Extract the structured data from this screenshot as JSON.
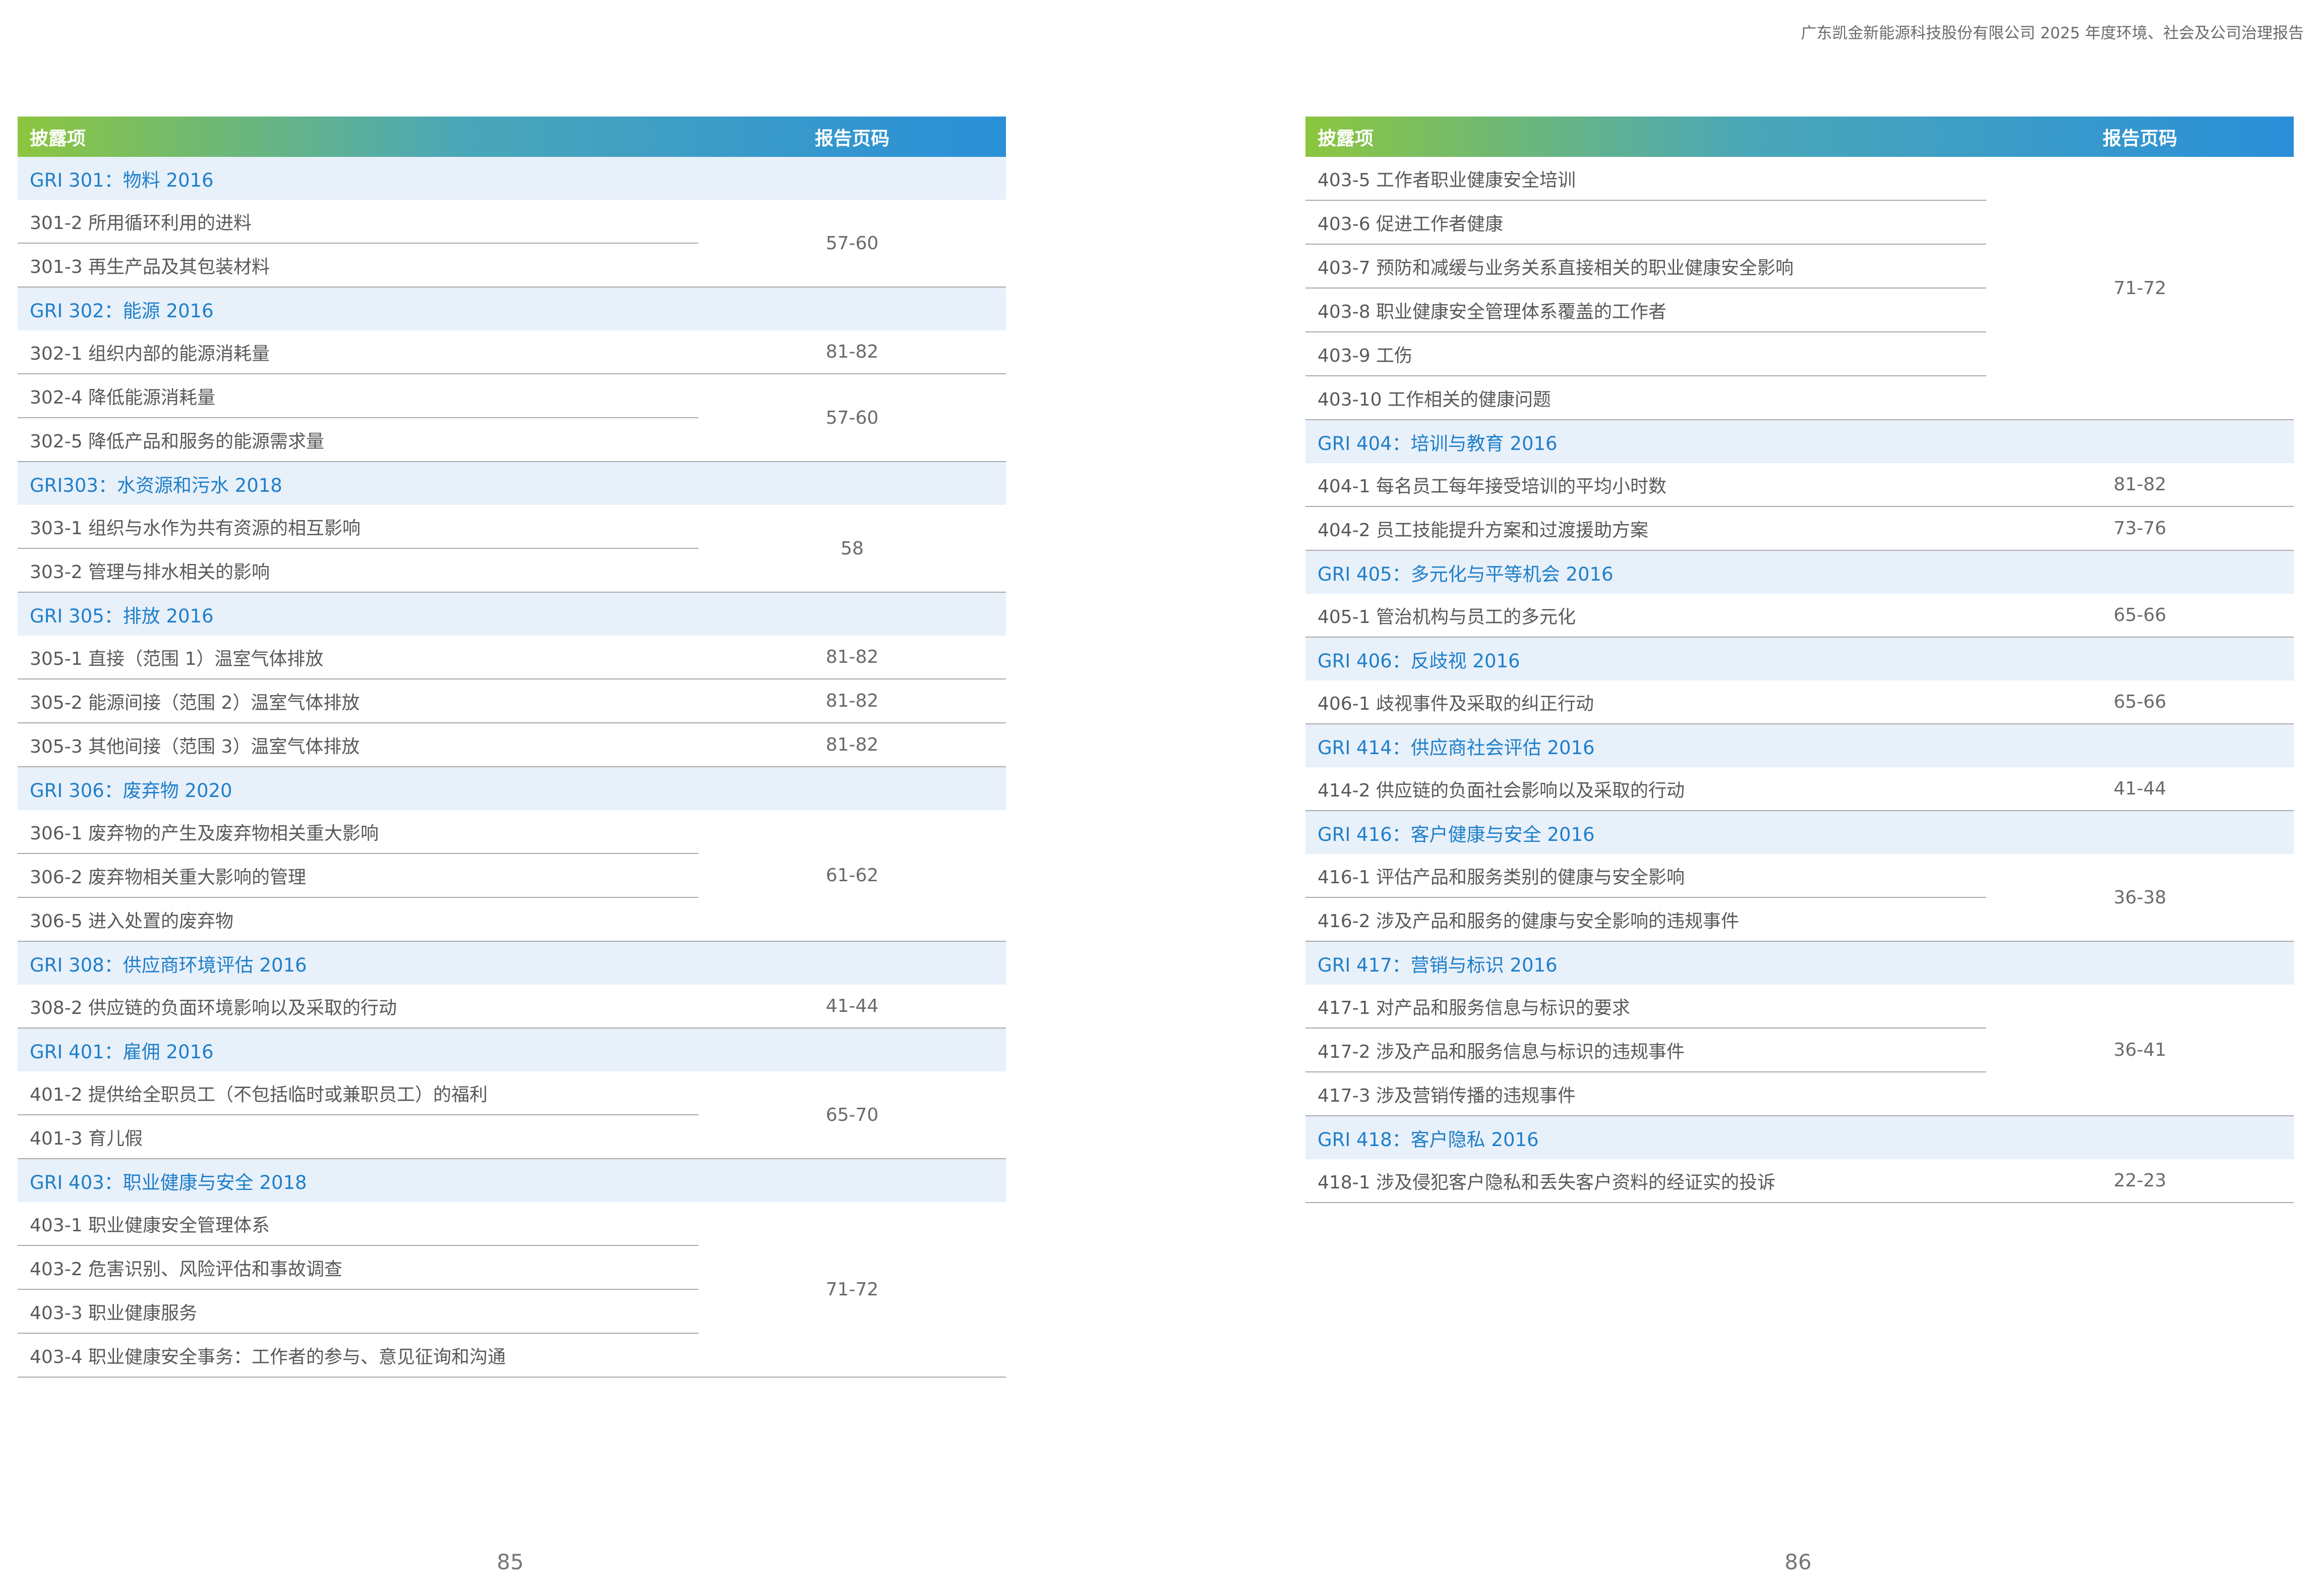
{
  "header": {
    "title": "广东凯金新能源科技股份有限公司   2025 年度环境、社会及公司治理报告"
  },
  "table": {
    "col_item": "披露项",
    "col_page": "报告页码"
  },
  "pages": {
    "left_number": "85",
    "right_number": "86"
  },
  "left_table": [
    {
      "section": "GRI 301：物料 2016"
    },
    {
      "item": "301-2 所用循环利用的进料",
      "page": "57-60",
      "rowspan": 2
    },
    {
      "item": "301-3 再生产品及其包装材料"
    },
    {
      "section": "GRI 302：能源 2016"
    },
    {
      "item": "302-1 组织内部的能源消耗量",
      "page": "81-82",
      "rowspan": 1
    },
    {
      "item": "302-4 降低能源消耗量",
      "page": "57-60",
      "rowspan": 2
    },
    {
      "item": "302-5 降低产品和服务的能源需求量"
    },
    {
      "section": "GRI303：水资源和污水 2018"
    },
    {
      "item": "303-1 组织与水作为共有资源的相互影响",
      "page": "58",
      "rowspan": 2
    },
    {
      "item": "303-2 管理与排水相关的影响"
    },
    {
      "section": "GRI 305：排放 2016"
    },
    {
      "item": "305-1 直接（范围 1）温室气体排放",
      "page": "81-82",
      "rowspan": 1
    },
    {
      "item": "305-2 能源间接（范围 2）温室气体排放",
      "page": "81-82",
      "rowspan": 1
    },
    {
      "item": "305-3 其他间接（范围 3）温室气体排放",
      "page": "81-82",
      "rowspan": 1
    },
    {
      "section": "GRI 306：废弃物 2020"
    },
    {
      "item": "306-1 废弃物的产生及废弃物相关重大影响",
      "page": "61-62",
      "rowspan": 3
    },
    {
      "item": "306-2 废弃物相关重大影响的管理"
    },
    {
      "item": "306-5 进入处置的废弃物"
    },
    {
      "section": "GRI 308：供应商环境评估 2016"
    },
    {
      "item": "308-2 供应链的负面环境影响以及采取的行动",
      "page": "41-44",
      "rowspan": 1
    },
    {
      "section": "GRI 401：雇佣 2016"
    },
    {
      "item": "401-2 提供给全职员工（不包括临时或兼职员工）的福利",
      "page": "65-70",
      "rowspan": 2
    },
    {
      "item": "401-3 育儿假"
    },
    {
      "section": "GRI 403：职业健康与安全 2018"
    },
    {
      "item": "403-1 职业健康安全管理体系",
      "page": "71-72",
      "rowspan": 4
    },
    {
      "item": "403-2 危害识别、风险评估和事故调查"
    },
    {
      "item": "403-3 职业健康服务"
    },
    {
      "item": "403-4 职业健康安全事务：工作者的参与、意见征询和沟通"
    }
  ],
  "right_table": [
    {
      "item": "403-5 工作者职业健康安全培训",
      "page": "71-72",
      "rowspan": 6
    },
    {
      "item": "403-6 促进工作者健康"
    },
    {
      "item": "403-7 预防和减缓与业务关系直接相关的职业健康安全影响"
    },
    {
      "item": "403-8 职业健康安全管理体系覆盖的工作者"
    },
    {
      "item": "403-9 工伤"
    },
    {
      "item": "403-10 工作相关的健康问题"
    },
    {
      "section": "GRI 404：培训与教育 2016"
    },
    {
      "item": "404-1 每名员工每年接受培训的平均小时数",
      "page": "81-82",
      "rowspan": 1
    },
    {
      "item": "404-2 员工技能提升方案和过渡援助方案",
      "page": "73-76",
      "rowspan": 1
    },
    {
      "section": "GRI 405：多元化与平等机会 2016"
    },
    {
      "item": "405-1 管治机构与员工的多元化",
      "page": "65-66",
      "rowspan": 1
    },
    {
      "section": "GRI 406：反歧视 2016"
    },
    {
      "item": "406-1 歧视事件及采取的纠正行动",
      "page": "65-66",
      "rowspan": 1
    },
    {
      "section": "GRI 414：供应商社会评估 2016"
    },
    {
      "item": "414-2 供应链的负面社会影响以及采取的行动",
      "page": "41-44",
      "rowspan": 1
    },
    {
      "section": "GRI 416：客户健康与安全 2016"
    },
    {
      "item": "416-1 评估产品和服务类别的健康与安全影响",
      "page": "36-38",
      "rowspan": 2
    },
    {
      "item": "416-2 涉及产品和服务的健康与安全影响的违规事件"
    },
    {
      "section": "GRI 417：营销与标识 2016"
    },
    {
      "item": "417-1 对产品和服务信息与标识的要求",
      "page": "36-41",
      "rowspan": 3
    },
    {
      "item": "417-2 涉及产品和服务信息与标识的违规事件"
    },
    {
      "item": "417-3 涉及营销传播的违规事件"
    },
    {
      "section": "GRI 418：客户隐私 2016"
    },
    {
      "item": "418-1 涉及侵犯客户隐私和丢失客户资料的经证实的投诉",
      "page": "22-23",
      "rowspan": 1
    }
  ]
}
